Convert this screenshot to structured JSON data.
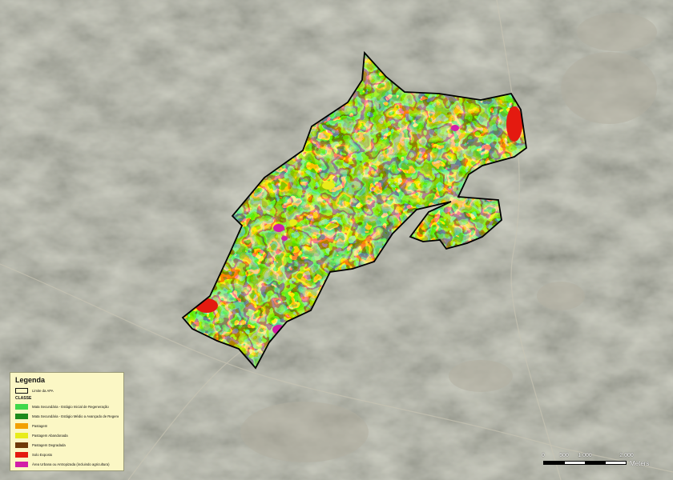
{
  "legend": {
    "title": "Legenda",
    "boundary_label": "Limite da APA",
    "section_label": "CLASSE",
    "classes": [
      {
        "label": "Mata Secundária - Estágio Inicial de Regeneração",
        "color": "#3fd84a"
      },
      {
        "label": "Mata Secundária - Estágio Médio a Avançado de Regeneração",
        "color": "#1e8a1c"
      },
      {
        "label": "Pastagem",
        "color": "#f2a000"
      },
      {
        "label": "Pastagem Abandonada",
        "color": "#e8ec1a"
      },
      {
        "label": "Pastagem Degradada",
        "color": "#6e3a08"
      },
      {
        "label": "Solo Exposto",
        "color": "#e41a10"
      },
      {
        "label": "Área Urbana ou Antropizada (incluindo agricultura)",
        "color": "#d21ea8"
      }
    ]
  },
  "scale_bar": {
    "ticks": [
      "0",
      "500",
      "1.000",
      "2.000"
    ],
    "tick_values": [
      0,
      500,
      1000,
      2000
    ],
    "max_value": 2000,
    "unit": "Meters"
  },
  "colors": {
    "satellite_base": "#76766a",
    "satellite_dark": "#4e5146",
    "satellite_light": "#a2a08f",
    "boundary": "#000000"
  }
}
